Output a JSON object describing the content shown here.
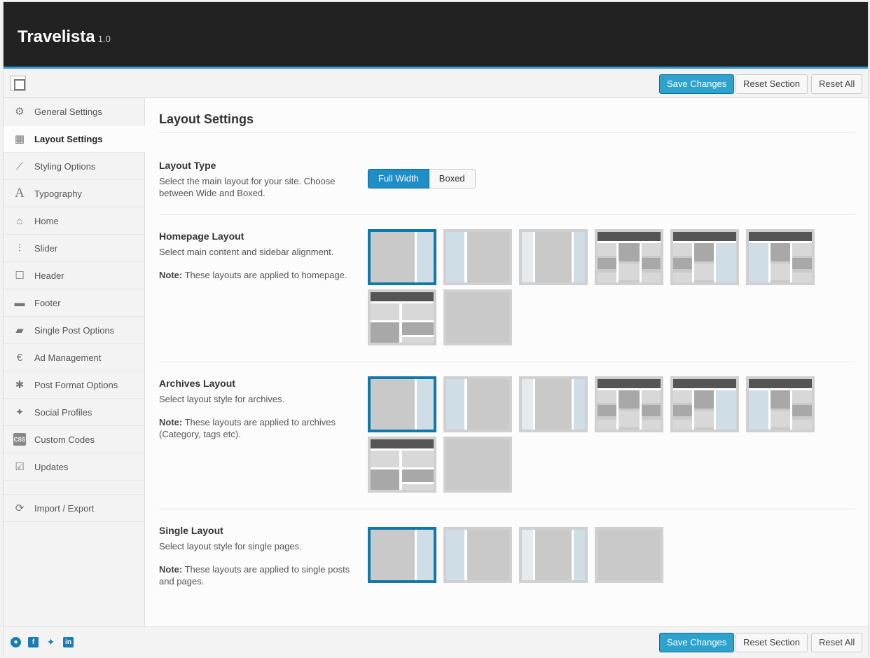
{
  "app": {
    "title": "Travelista",
    "version": "1.0"
  },
  "toolbar": {
    "save": "Save Changes",
    "reset_section": "Reset Section",
    "reset_all": "Reset All"
  },
  "sidebar": {
    "items": [
      {
        "label": "General Settings",
        "icon": "cogs-icon"
      },
      {
        "label": "Layout Settings",
        "icon": "layout-icon",
        "active": true
      },
      {
        "label": "Styling Options",
        "icon": "brush-icon"
      },
      {
        "label": "Typography",
        "icon": "font-icon"
      },
      {
        "label": "Home",
        "icon": "home-icon"
      },
      {
        "label": "Slider",
        "icon": "sliders-icon"
      },
      {
        "label": "Header",
        "icon": "square-icon"
      },
      {
        "label": "Footer",
        "icon": "minus-icon"
      },
      {
        "label": "Single Post Options",
        "icon": "folder-icon"
      },
      {
        "label": "Ad Management",
        "icon": "euro-icon"
      },
      {
        "label": "Post Format Options",
        "icon": "asterisk-icon"
      },
      {
        "label": "Social Profiles",
        "icon": "twitter-icon"
      },
      {
        "label": "Custom Codes",
        "icon": "css-icon"
      },
      {
        "label": "Updates",
        "icon": "check-icon"
      },
      {
        "label": "Import / Export",
        "icon": "refresh-icon"
      }
    ]
  },
  "main": {
    "title": "Layout Settings",
    "layout_type": {
      "label": "Layout Type",
      "desc": "Select the main layout for your site. Choose between Wide and Boxed.",
      "options": [
        "Full Width",
        "Boxed"
      ],
      "selected": "Full Width"
    },
    "homepage": {
      "label": "Homepage Layout",
      "desc": "Select main content and sidebar alignment.",
      "note_label": "Note:",
      "note": "These layouts are applied to homepage."
    },
    "archives": {
      "label": "Archives Layout",
      "desc": "Select layout style for archives.",
      "note_label": "Note:",
      "note": "These layouts are applied to archives (Category, tags etc)."
    },
    "single": {
      "label": "Single Layout",
      "desc": "Select layout style for single pages.",
      "note_label": "Note:",
      "note": "These layouts are applied to single posts and pages."
    }
  },
  "footer_social": [
    "github-icon",
    "facebook-icon",
    "twitter-icon",
    "linkedin-icon"
  ]
}
